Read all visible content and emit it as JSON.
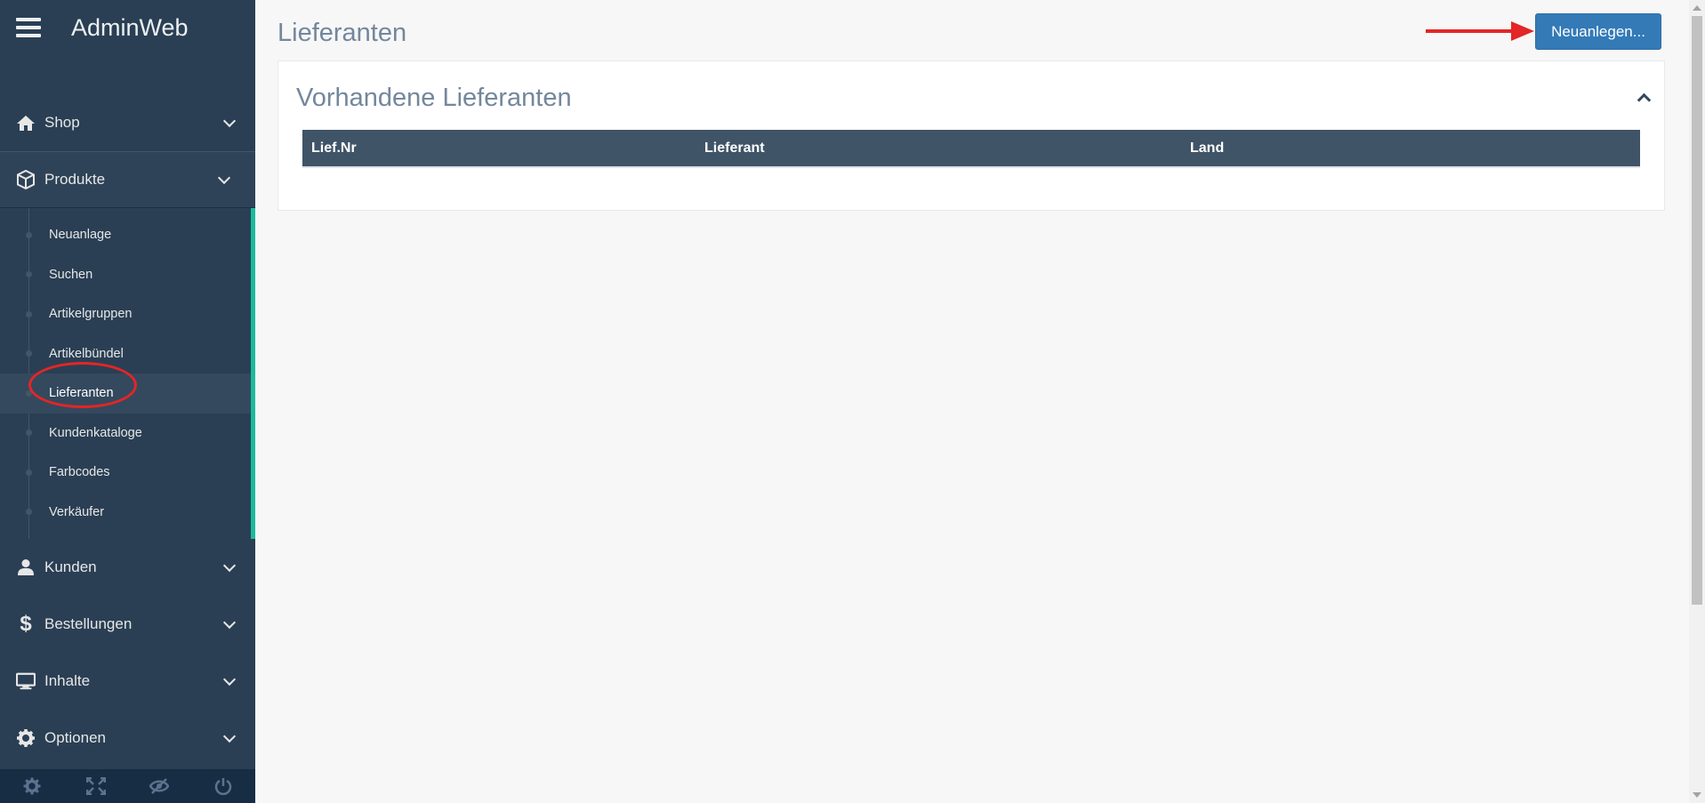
{
  "app": {
    "title": "AdminWeb"
  },
  "sidebar": {
    "items": [
      {
        "label": "Shop",
        "icon": "home-icon"
      },
      {
        "label": "Produkte",
        "icon": "cube-icon"
      },
      {
        "label": "Kunden",
        "icon": "user-icon"
      },
      {
        "label": "Bestellungen",
        "icon": "dollar-icon"
      },
      {
        "label": "Inhalte",
        "icon": "desktop-icon"
      },
      {
        "label": "Optionen",
        "icon": "gear-icon"
      }
    ],
    "submenu": [
      "Neuanlage",
      "Suchen",
      "Artikelgruppen",
      "Artikelbündel",
      "Lieferanten",
      "Kundenkataloge",
      "Farbcodes",
      "Verkäufer"
    ],
    "current_submenu": "Lieferanten",
    "footer_icons": [
      "settings-icon",
      "fullscreen-icon",
      "lock-icon",
      "power-icon"
    ]
  },
  "page": {
    "title": "Lieferanten",
    "new_button_label": "Neuanlegen...",
    "panel_title": "Vorhandene Lieferanten",
    "table": {
      "columns": [
        "Lief.Nr",
        "Lieferant",
        "Land"
      ],
      "rows": []
    }
  },
  "colors": {
    "sidebar_bg": "#2a3f54",
    "accent_green": "#1abb9c",
    "primary_button": "#337ab7",
    "table_header": "#405467",
    "annotation_red": "#e32626"
  }
}
